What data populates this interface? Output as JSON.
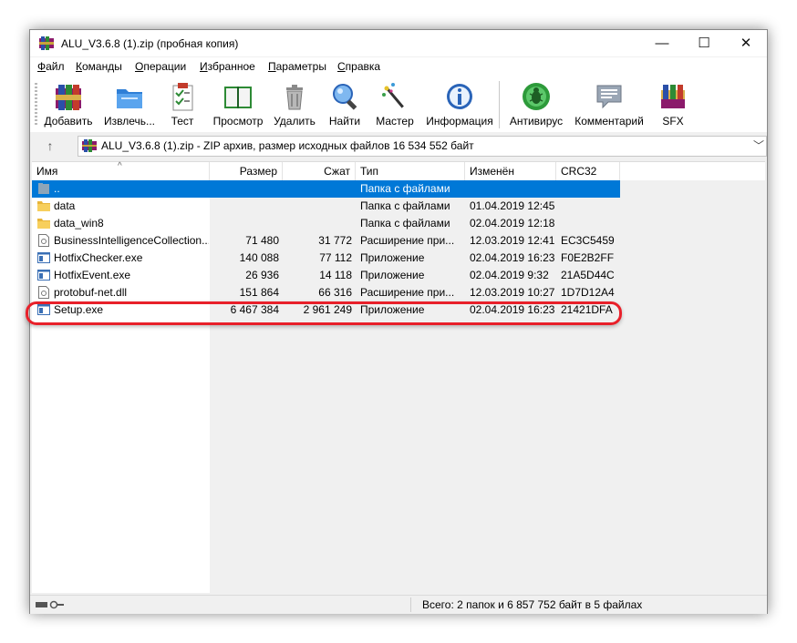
{
  "window": {
    "title": "ALU_V3.6.8 (1).zip (пробная копия)",
    "minimize_glyph": "—",
    "maximize_glyph": "☐",
    "close_glyph": "✕"
  },
  "menu": [
    {
      "underline": "Ф",
      "rest": "айл"
    },
    {
      "underline": "К",
      "rest": "оманды"
    },
    {
      "underline": "О",
      "rest": "перации"
    },
    {
      "underline": "И",
      "rest": "збранное"
    },
    {
      "underline": "П",
      "rest": "араметры"
    },
    {
      "underline": "С",
      "rest": "правка"
    }
  ],
  "toolbar": [
    {
      "label": "Добавить",
      "icon": "archive-add-icon"
    },
    {
      "label": "Извлечь...",
      "icon": "folder-extract-icon"
    },
    {
      "label": "Тест",
      "icon": "clipboard-test-icon"
    },
    {
      "label": "Просмотр",
      "icon": "book-view-icon"
    },
    {
      "label": "Удалить",
      "icon": "trash-icon"
    },
    {
      "label": "Найти",
      "icon": "magnifier-icon"
    },
    {
      "label": "Мастер",
      "icon": "magic-wand-icon"
    },
    {
      "label": "Информация",
      "icon": "info-icon"
    },
    {
      "label": "Антивирус",
      "icon": "antivirus-bug-icon"
    },
    {
      "label": "Комментарий",
      "icon": "comment-icon"
    },
    {
      "label": "SFX",
      "icon": "sfx-archive-icon"
    }
  ],
  "address": {
    "up_glyph": "↑",
    "text": "ALU_V3.6.8 (1).zip - ZIP архив, размер исходных файлов 16 534 552 байт",
    "dropdown_glyph": "﹀"
  },
  "columns": {
    "name": "Имя",
    "size": "Размер",
    "packed": "Сжат",
    "type": "Тип",
    "modified": "Изменён",
    "crc": "CRC32",
    "sort_glyph": "^"
  },
  "files": [
    {
      "name": "..",
      "size": "",
      "packed": "",
      "type": "Папка с файлами",
      "modified": "",
      "crc": "",
      "icon": "parent-folder-icon",
      "selected": true
    },
    {
      "name": "data",
      "size": "",
      "packed": "",
      "type": "Папка с файлами",
      "modified": "01.04.2019 12:45",
      "crc": "",
      "icon": "folder-icon",
      "selected": false
    },
    {
      "name": "data_win8",
      "size": "",
      "packed": "",
      "type": "Папка с файлами",
      "modified": "02.04.2019 12:18",
      "crc": "",
      "icon": "folder-icon",
      "selected": false
    },
    {
      "name": "BusinessIntelligenceCollection...",
      "size": "71 480",
      "packed": "31 772",
      "type": "Расширение при...",
      "modified": "12.03.2019 12:41",
      "crc": "EC3C5459",
      "icon": "dll-icon",
      "selected": false
    },
    {
      "name": "HotfixChecker.exe",
      "size": "140 088",
      "packed": "77 112",
      "type": "Приложение",
      "modified": "02.04.2019 16:23",
      "crc": "F0E2B2FF",
      "icon": "exe-icon",
      "selected": false
    },
    {
      "name": "HotfixEvent.exe",
      "size": "26 936",
      "packed": "14 118",
      "type": "Приложение",
      "modified": "02.04.2019 9:32",
      "crc": "21A5D44C",
      "icon": "exe-icon",
      "selected": false
    },
    {
      "name": "protobuf-net.dll",
      "size": "151 864",
      "packed": "66 316",
      "type": "Расширение при...",
      "modified": "12.03.2019 10:27",
      "crc": "1D7D12A4",
      "icon": "dll-icon",
      "selected": false
    },
    {
      "name": "Setup.exe",
      "size": "6 467 384",
      "packed": "2 961 249",
      "type": "Приложение",
      "modified": "02.04.2019 16:23",
      "crc": "21421DFA",
      "icon": "exe-icon",
      "selected": false
    }
  ],
  "status": {
    "text": "Всего: 2 папок и 6 857 752 байт в 5 файлах"
  },
  "colors": {
    "selection": "#0078d7",
    "highlight_border": "#e8202a"
  }
}
